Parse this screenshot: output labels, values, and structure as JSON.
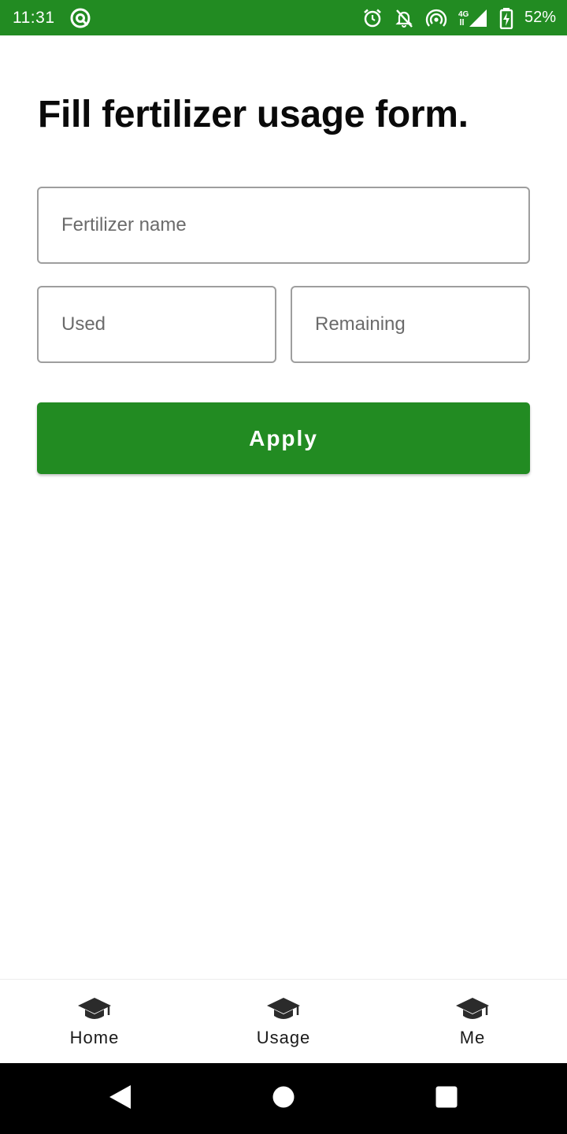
{
  "status_bar": {
    "time": "11:31",
    "battery": "52%",
    "background": "#228B22",
    "icons": [
      "app-notification-icon",
      "alarm-icon",
      "notifications-off-icon",
      "hotspot-icon",
      "signal-4g-icon",
      "battery-charging-icon"
    ]
  },
  "page": {
    "title": "Fill fertilizer usage form."
  },
  "form": {
    "fertilizer_name_placeholder": "Fertilizer name",
    "used_placeholder": "Used",
    "remaining_placeholder": "Remaining",
    "apply_label": "Apply",
    "accent_color": "#228B22"
  },
  "bottom_nav": {
    "items": [
      {
        "label": "Home",
        "icon": "graduation-cap-icon"
      },
      {
        "label": "Usage",
        "icon": "graduation-cap-icon"
      },
      {
        "label": "Me",
        "icon": "graduation-cap-icon"
      }
    ]
  },
  "system_nav": {
    "buttons": [
      "back-icon",
      "home-icon",
      "recents-icon"
    ]
  }
}
